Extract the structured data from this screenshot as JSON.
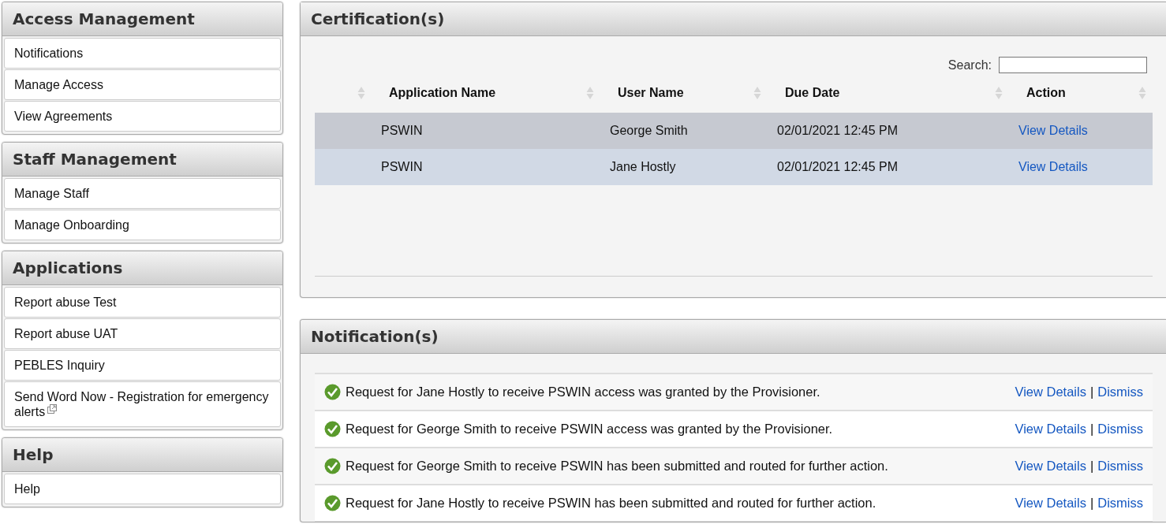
{
  "sidebar": {
    "sections": [
      {
        "title": "Access Management",
        "items": [
          {
            "label": "Notifications",
            "external": false
          },
          {
            "label": "Manage Access",
            "external": false
          },
          {
            "label": "View Agreements",
            "external": false
          }
        ]
      },
      {
        "title": "Staff Management",
        "items": [
          {
            "label": "Manage Staff",
            "external": false
          },
          {
            "label": "Manage Onboarding",
            "external": false
          }
        ]
      },
      {
        "title": "Applications",
        "items": [
          {
            "label": "Report abuse Test",
            "external": false
          },
          {
            "label": "Report abuse UAT",
            "external": false
          },
          {
            "label": "PEBLES Inquiry",
            "external": false
          },
          {
            "label": "Send Word Now - Registration for emergency alerts",
            "external": true
          }
        ]
      },
      {
        "title": "Help",
        "items": [
          {
            "label": "Help",
            "external": false
          }
        ]
      }
    ]
  },
  "certifications": {
    "title": "Certification(s)",
    "search": {
      "label": "Search:"
    },
    "table": {
      "columns": [
        "Application Name",
        "User Name",
        "Due Date",
        "Action"
      ],
      "rows": [
        {
          "selected": true,
          "cells": [
            "PSWIN",
            "George Smith",
            "02/01/2021 12:45 PM"
          ],
          "action": "View Details"
        },
        {
          "selected": false,
          "cells": [
            "PSWIN",
            "Jane Hostly",
            "02/01/2021 12:45 PM"
          ],
          "action": "View Details"
        }
      ]
    }
  },
  "notifications": {
    "title": "Notification(s)",
    "items": [
      {
        "message": "Request for Jane Hostly to receive PSWIN access was granted by the Provisioner.",
        "view": "View Details",
        "separator": "|",
        "dismiss": "Dismiss"
      },
      {
        "message": "Request for George Smith to receive PSWIN access was granted by the Provisioner.",
        "view": "View Details",
        "separator": "|",
        "dismiss": "Dismiss"
      },
      {
        "message": "Request for George Smith to receive PSWIN has been submitted and routed for further action.",
        "view": "View Details",
        "separator": "|",
        "dismiss": "Dismiss"
      },
      {
        "message": "Request for Jane Hostly to receive PSWIN has been submitted and routed for further action.",
        "view": "View Details",
        "separator": "|",
        "dismiss": "Dismiss"
      }
    ]
  }
}
